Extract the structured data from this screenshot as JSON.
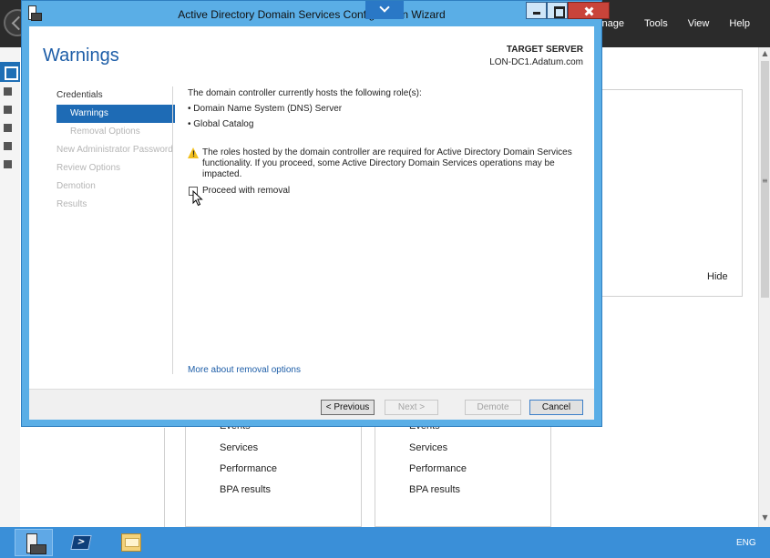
{
  "server_manager": {
    "menu": [
      "Manage",
      "Tools",
      "View",
      "Help"
    ],
    "hide_label": "Hide",
    "tiles": [
      {
        "items": [
          "Events",
          "Services",
          "Performance",
          "BPA results"
        ]
      },
      {
        "items": [
          "Events",
          "Services",
          "Performance",
          "BPA results"
        ]
      }
    ]
  },
  "wizard": {
    "title": "Active Directory Domain Services Configuration Wizard",
    "heading": "Warnings",
    "target_server_label": "TARGET SERVER",
    "target_server_name": "LON-DC1.Adatum.com",
    "nav": [
      {
        "label": "Credentials",
        "state": "done"
      },
      {
        "label": "Warnings",
        "state": "active"
      },
      {
        "label": "Removal Options",
        "state": "disabled-sub"
      },
      {
        "label": "New Administrator Password",
        "state": "disabled"
      },
      {
        "label": "Review Options",
        "state": "disabled"
      },
      {
        "label": "Demotion",
        "state": "disabled"
      },
      {
        "label": "Results",
        "state": "disabled"
      }
    ],
    "intro": "The domain controller currently hosts the following role(s):",
    "roles": [
      "• Domain Name System (DNS) Server",
      "• Global Catalog"
    ],
    "warning_text": "The roles hosted by the domain controller are required for Active Directory Domain Services functionality. If you proceed, some Active Directory Domain Services operations may be impacted.",
    "proceed_label": "Proceed with removal",
    "proceed_checked": false,
    "more_link": "More about removal options",
    "buttons": {
      "previous": "< Previous",
      "next": "Next >",
      "demote": "Demote",
      "cancel": "Cancel"
    }
  },
  "taskbar": {
    "language": "ENG"
  }
}
